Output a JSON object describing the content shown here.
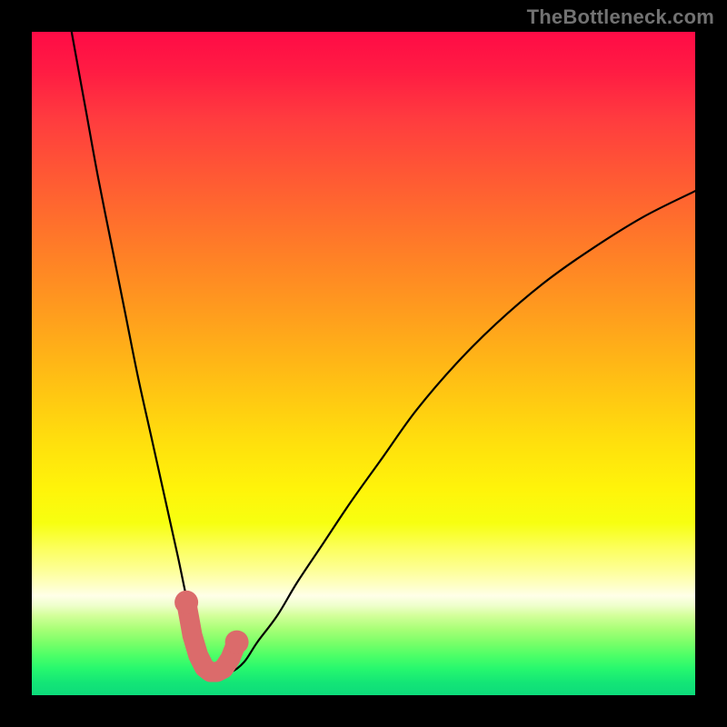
{
  "watermark": "TheBottleneck.com",
  "chart_data": {
    "type": "line",
    "title": "",
    "xlabel": "",
    "ylabel": "",
    "xlim": [
      0,
      100
    ],
    "ylim": [
      0,
      100
    ],
    "series": [
      {
        "name": "bottleneck-curve",
        "x": [
          6,
          8,
          10,
          12,
          14,
          16,
          18,
          20,
          22,
          23.5,
          25,
          26.5,
          28,
          30,
          32,
          34,
          37,
          40,
          44,
          48,
          53,
          58,
          64,
          70,
          77,
          84,
          92,
          100
        ],
        "values": [
          100,
          89,
          78,
          68,
          58,
          48,
          39,
          30,
          21,
          14,
          9,
          5.5,
          3.5,
          3.5,
          5,
          8,
          12,
          17,
          23,
          29,
          36,
          43,
          50,
          56,
          62,
          67,
          72,
          76
        ]
      }
    ],
    "marker": {
      "name": "bottleneck-minimum-marker",
      "color": "#db6b6b",
      "points_x": [
        23.3,
        24.2,
        25.1,
        26.0,
        26.9,
        27.9,
        28.9,
        29.9,
        30.9
      ],
      "points_y": [
        14.0,
        9.0,
        6.0,
        4.2,
        3.5,
        3.5,
        4.0,
        5.5,
        8.0
      ]
    }
  }
}
